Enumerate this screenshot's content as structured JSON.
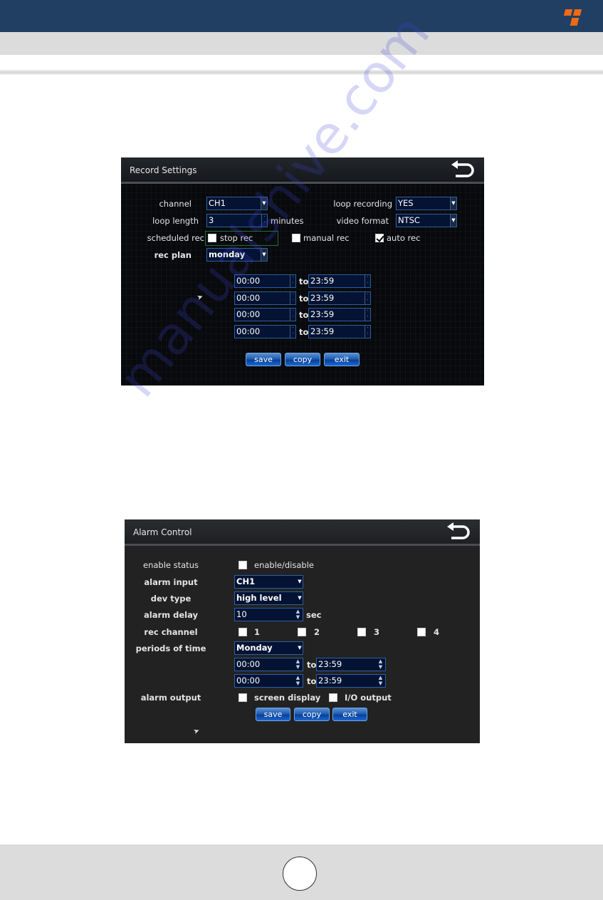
{
  "page": {
    "brand_color": "#213f63",
    "logo_color": "#ef6a12",
    "page_number": "",
    "watermark": "manualshive.com"
  },
  "record_settings": {
    "title": "Record Settings",
    "back_icon": "back-arrow-icon",
    "channel": {
      "label": "channel",
      "value": "CH1"
    },
    "loop_recording": {
      "label": "loop recording",
      "value": "YES"
    },
    "loop_length": {
      "label": "loop length",
      "value": "3",
      "unit": "minutes"
    },
    "video_format": {
      "label": "video format",
      "value": "NTSC"
    },
    "scheduled_rec": {
      "label": "scheduled rec",
      "options": [
        {
          "label": "stop rec",
          "checked": false
        },
        {
          "label": "manual rec",
          "checked": false
        },
        {
          "label": "auto rec",
          "checked": true
        }
      ]
    },
    "rec_plan": {
      "label": "rec plan",
      "value": "monday"
    },
    "periods": [
      {
        "from": "00:00",
        "to_label": "to",
        "to": "23:59"
      },
      {
        "from": "00:00",
        "to_label": "to",
        "to": "23:59"
      },
      {
        "from": "00:00",
        "to_label": "to",
        "to": "23:59"
      },
      {
        "from": "00:00",
        "to_label": "to",
        "to": "23:59"
      }
    ],
    "buttons": {
      "save": "save",
      "copy": "copy",
      "exit": "exit"
    }
  },
  "alarm_control": {
    "title": "Alarm Control",
    "back_icon": "back-arrow-icon",
    "enable_status": {
      "label": "enable status",
      "option": "enable/disable",
      "checked": false
    },
    "alarm_input": {
      "label": "alarm input",
      "value": "CH1"
    },
    "dev_type": {
      "label": "dev type",
      "value": "high level"
    },
    "alarm_delay": {
      "label": "alarm delay",
      "value": "10",
      "unit": "sec"
    },
    "rec_channel": {
      "label": "rec channel",
      "channels": [
        {
          "label": "1",
          "checked": false
        },
        {
          "label": "2",
          "checked": false
        },
        {
          "label": "3",
          "checked": false
        },
        {
          "label": "4",
          "checked": false
        }
      ]
    },
    "periods_of_time": {
      "label": "periods of time",
      "value": "Monday"
    },
    "periods": [
      {
        "from": "00:00",
        "to_label": "to",
        "to": "23:59"
      },
      {
        "from": "00:00",
        "to_label": "to",
        "to": "23:59"
      }
    ],
    "alarm_output": {
      "label": "alarm output",
      "options": [
        {
          "label": "screen display",
          "checked": false
        },
        {
          "label": "I/O output",
          "checked": false
        }
      ]
    },
    "buttons": {
      "save": "save",
      "copy": "copy",
      "exit": "exit"
    }
  }
}
